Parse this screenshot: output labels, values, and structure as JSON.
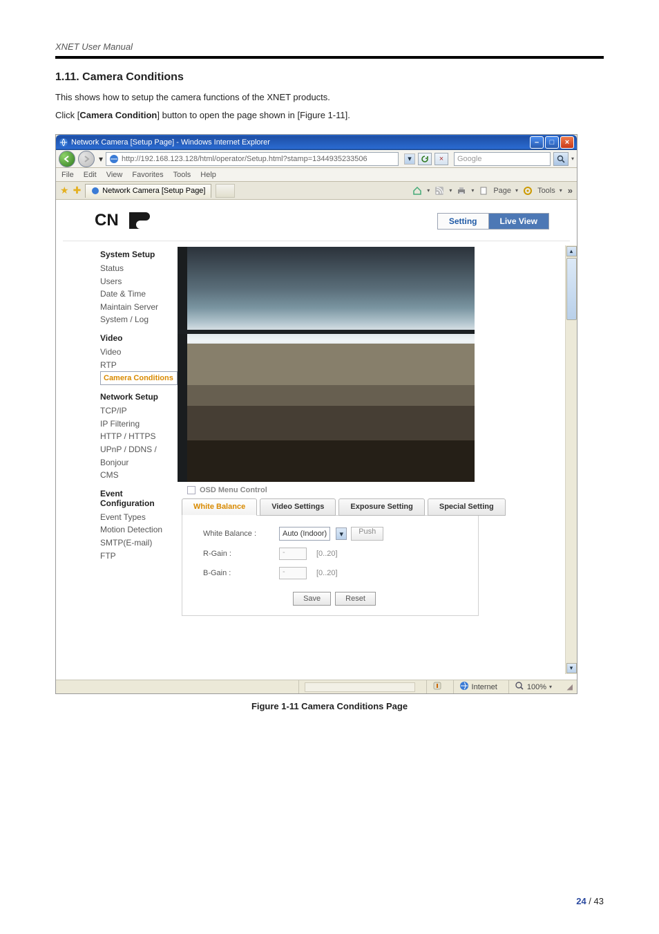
{
  "doc": {
    "header": "XNET User Manual",
    "section_title": "1.11. Camera Conditions",
    "p1": "This shows how to setup the camera functions of the XNET products.",
    "p2a": "Click [",
    "p2b": "Camera Condition",
    "p2c": "] button to open the page shown in [Figure 1-11].",
    "caption": "Figure 1-11 Camera Conditions Page",
    "page_cur": "24",
    "page_sep": " / ",
    "page_tot": "43"
  },
  "win": {
    "title": "Network Camera [Setup Page] - Windows Internet Explorer",
    "url": "http://192.168.123.128/html/operator/Setup.html?stamp=1344935233506",
    "search_placeholder": "Google",
    "menubar": [
      "File",
      "Edit",
      "View",
      "Favorites",
      "Tools",
      "Help"
    ],
    "tab_label": "Network Camera [Setup Page]",
    "tools": {
      "page": "Page",
      "tools": "Tools"
    },
    "status_internet": "Internet",
    "status_zoom": "100%"
  },
  "brand": {
    "name": "CNB",
    "setting": "Setting",
    "live": "Live View"
  },
  "sidebar": {
    "g1": "System Setup",
    "g1_items": [
      "Status",
      "Users",
      "Date & Time",
      "Maintain Server",
      "System / Log"
    ],
    "g2": "Video",
    "g2_items": [
      "Video",
      "RTP",
      "Camera Conditions"
    ],
    "g2_selected": 2,
    "g3": "Network Setup",
    "g3_items": [
      "TCP/IP",
      "IP Filtering",
      "HTTP / HTTPS",
      "UPnP / DDNS / Bonjour",
      "CMS"
    ],
    "g4": "Event Configuration",
    "g4_items": [
      "Event Types",
      "Motion Detection",
      "SMTP(E-mail)",
      "FTP"
    ]
  },
  "osd": {
    "label": "OSD Menu Control"
  },
  "tabs": [
    "White Balance",
    "Video Settings",
    "Exposure Setting",
    "Special Setting"
  ],
  "wb": {
    "label": "White Balance :",
    "value": "Auto (Indoor)",
    "push": "Push",
    "rgain_label": "R-Gain :",
    "rgain_val": "-",
    "rgain_range": "[0..20]",
    "bgain_label": "B-Gain :",
    "bgain_val": "-",
    "bgain_range": "[0..20]",
    "save": "Save",
    "reset": "Reset"
  }
}
